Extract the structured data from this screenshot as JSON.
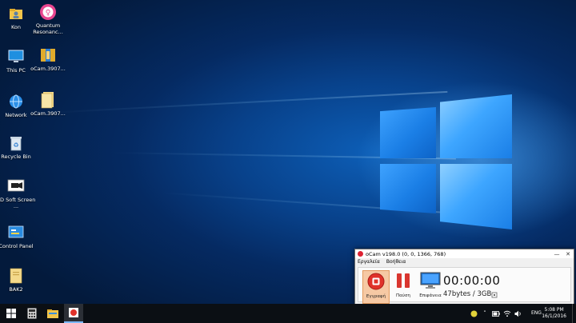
{
  "desktop_icons": [
    {
      "label": "Kon",
      "icon": "user-folder-icon"
    },
    {
      "label": "Quantum Resonanc...",
      "icon": "quantum-app-icon"
    },
    {
      "label": "This PC",
      "icon": "computer-icon"
    },
    {
      "label": "oCam.3907...",
      "icon": "archive-icon"
    },
    {
      "label": "Network",
      "icon": "network-icon"
    },
    {
      "label": "oCam.3907...",
      "icon": "document-icon"
    },
    {
      "label": "Recycle Bin",
      "icon": "recycle-bin-icon"
    },
    {
      "label": "ZD Soft Screen ...",
      "icon": "zd-soft-icon"
    },
    {
      "label": "Control Panel",
      "icon": "control-panel-icon"
    },
    {
      "label": "ΒΑΚ2",
      "icon": "folder-icon"
    }
  ],
  "ocam": {
    "title": "oCam v198.0 (0, 0, 1366, 768)",
    "menu": [
      "Εργαλεία",
      "Βοήθεια"
    ],
    "tools": {
      "record": "Εγγραφή",
      "pause": "Παύση",
      "screen": "Επιφάνεια"
    },
    "timer": "00:00:00",
    "size": "47bytes / 3GB"
  },
  "taskbar": {
    "language": "ENG",
    "time": "5:08 PM",
    "date": "16/1/2016"
  },
  "colors": {
    "record_red": "#e0322a",
    "pause_red": "#d9362f",
    "taskbar": "#0b0f14",
    "accent_blue": "#1b7fe6"
  }
}
